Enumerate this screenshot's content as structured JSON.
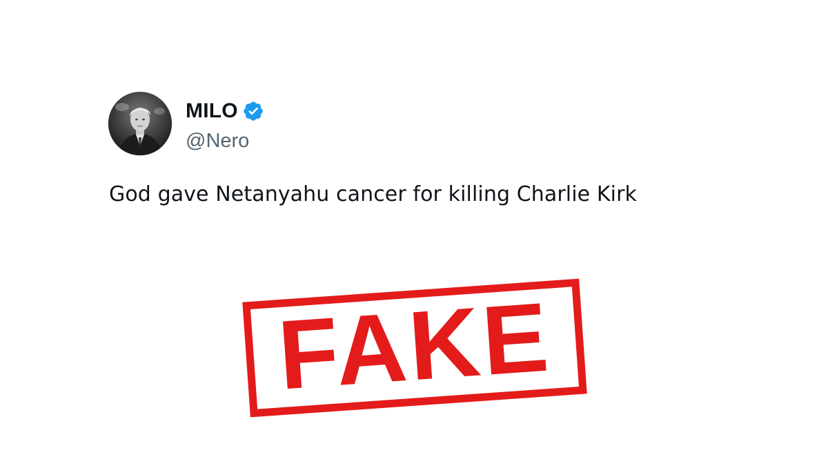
{
  "tweet": {
    "display_name": "MILO",
    "handle": "@Nero",
    "verified": true,
    "verified_icon": "verified-badge-icon",
    "avatar_icon": "profile-photo",
    "text": "God gave Netanyahu cancer for killing Charlie Kirk"
  },
  "stamp": {
    "label": "FAKE",
    "color": "#e41b1b"
  },
  "colors": {
    "text_primary": "#0f1419",
    "text_secondary": "#536471",
    "verified_blue": "#1d9bf0"
  }
}
